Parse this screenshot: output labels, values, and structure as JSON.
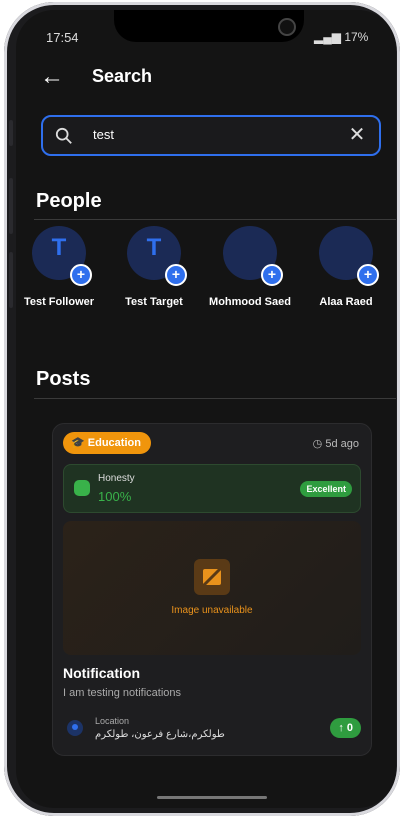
{
  "status": {
    "time": "17:54",
    "battery": "17%"
  },
  "header": {
    "title": "Search"
  },
  "search": {
    "value": "test"
  },
  "people": {
    "title": "People",
    "items": [
      {
        "name": "Test Follower",
        "initial": "T"
      },
      {
        "name": "Test Target",
        "initial": "T"
      },
      {
        "name": "Mohmood Saed",
        "initial": ""
      },
      {
        "name": "Alaa Raed",
        "initial": ""
      }
    ]
  },
  "posts": {
    "title": "Posts",
    "items": [
      {
        "category": "Education",
        "time_ago": "5d ago",
        "honesty_label": "Honesty",
        "honesty_value": "100%",
        "honesty_badge": "Excellent",
        "image_placeholder": "Image unavailable",
        "title": "Notification",
        "body": "I am testing notifications",
        "location_label": "Location",
        "location_value": "طولكرم،شارع فرعون، طولكرم",
        "upvotes": "↑ 0"
      }
    ]
  },
  "colors": {
    "accent": "#2f6fed",
    "category": "#f0950c",
    "success": "#2f9c3f"
  }
}
